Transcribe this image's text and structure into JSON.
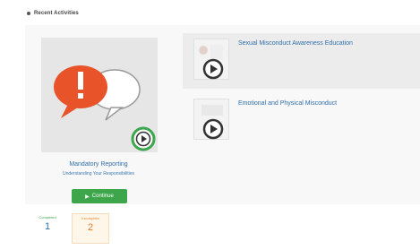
{
  "section": {
    "title": "Recent Activities"
  },
  "featured": {
    "title": "Mandatory Reporting",
    "subtitle": "Understanding Your Responsibilities",
    "continue_label": "Continue",
    "icon": "speech-bubbles-alert-icon"
  },
  "courses": [
    {
      "title": "Sexual Misconduct Awareness Education",
      "icon": "play-icon"
    },
    {
      "title": "Emotional and Physical Misconduct",
      "icon": "play-icon"
    }
  ],
  "stats": {
    "completed": {
      "label": "Completed",
      "value": "1"
    },
    "incomplete": {
      "label": "Incomplete",
      "value": "2"
    }
  },
  "colors": {
    "accent_green": "#3da64b",
    "link_blue": "#2f6ea8",
    "alert_orange": "#e8532a",
    "incomplete_orange": "#e07b2c"
  }
}
